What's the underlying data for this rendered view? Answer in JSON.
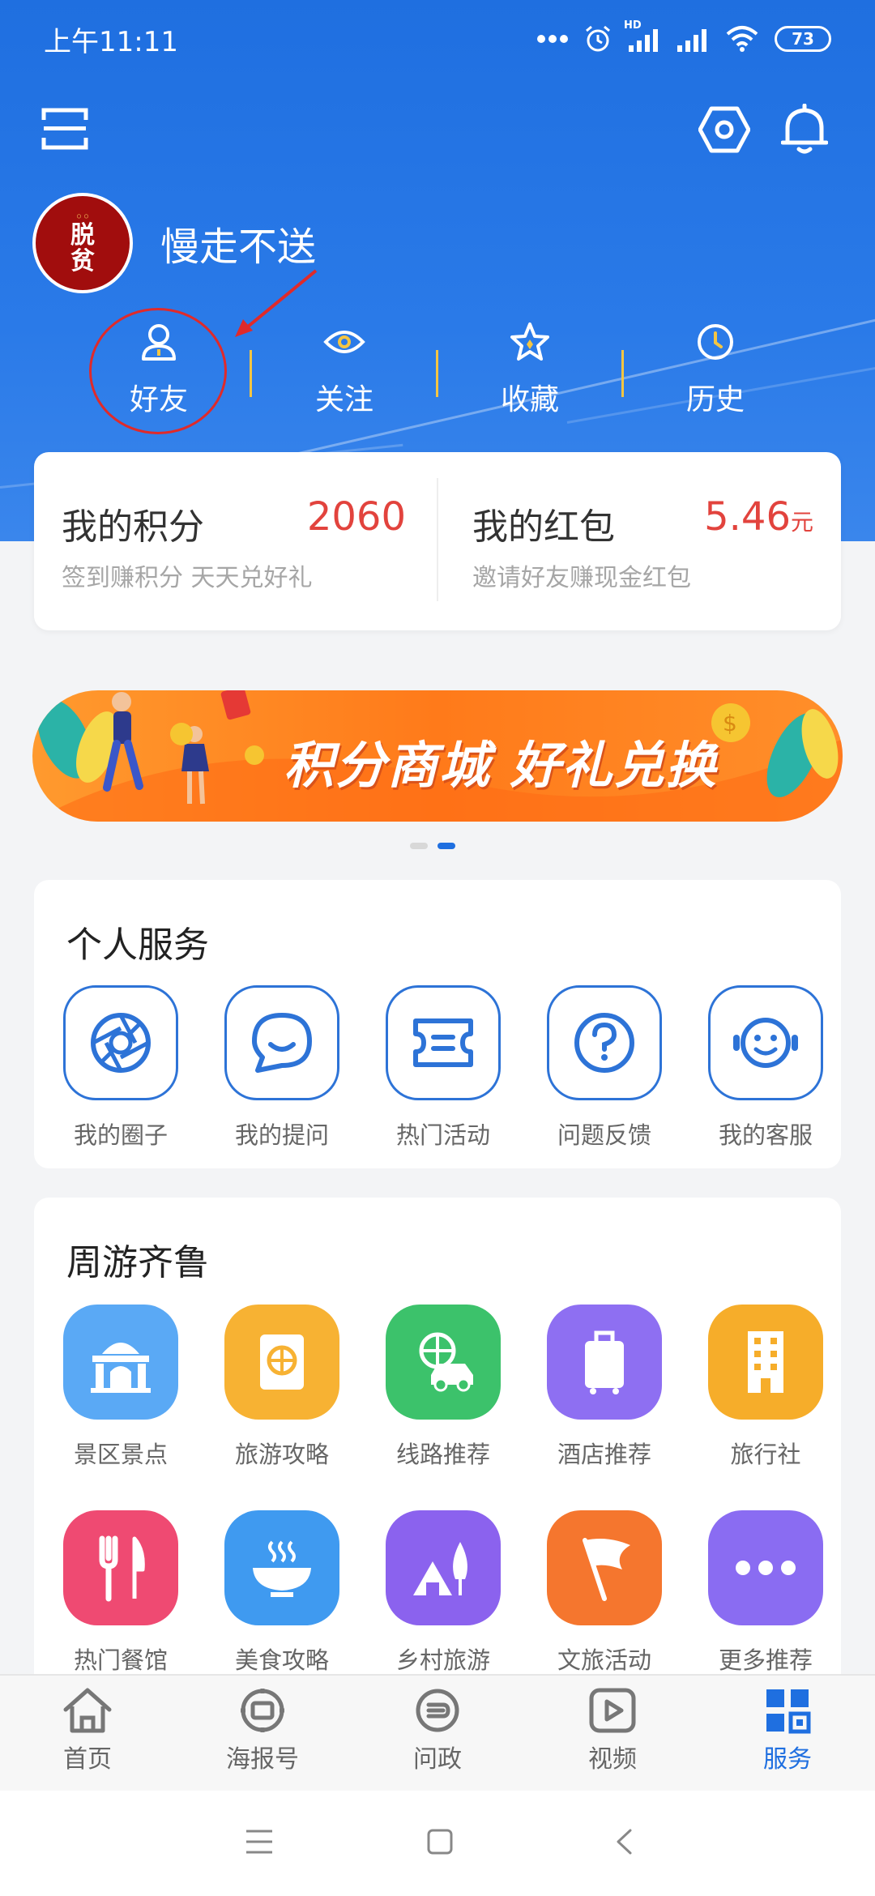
{
  "status_bar": {
    "time": "上午11:11",
    "battery": "73",
    "network_label": "HD"
  },
  "profile": {
    "avatar_text_1": "脱",
    "avatar_text_2": "贫",
    "username": "慢走不送"
  },
  "quick_links": [
    {
      "label": "好友",
      "icon": "user-icon"
    },
    {
      "label": "关注",
      "icon": "eye-icon"
    },
    {
      "label": "收藏",
      "icon": "star-icon"
    },
    {
      "label": "历史",
      "icon": "clock-icon"
    }
  ],
  "points": {
    "title": "我的积分",
    "value": "2060",
    "subtitle": "签到赚积分 天天兑好礼"
  },
  "red_packet": {
    "title": "我的红包",
    "value": "5.46",
    "unit": "元",
    "subtitle": "邀请好友赚现金红包"
  },
  "banner": {
    "text": "积分商城 好礼兑换",
    "page_count": 2,
    "active_page": 2
  },
  "personal_services": {
    "title": "个人服务",
    "items": [
      {
        "label": "我的圈子",
        "icon": "aperture-icon"
      },
      {
        "label": "我的提问",
        "icon": "chat-bubble-icon"
      },
      {
        "label": "热门活动",
        "icon": "ticket-icon"
      },
      {
        "label": "问题反馈",
        "icon": "question-icon"
      },
      {
        "label": "我的客服",
        "icon": "headset-icon"
      }
    ]
  },
  "travel": {
    "title": "周游齐鲁",
    "row1": [
      {
        "label": "景区景点",
        "icon": "landmark-icon",
        "color": "#5aa9f5"
      },
      {
        "label": "旅游攻略",
        "icon": "passport-icon",
        "color": "#f7b233"
      },
      {
        "label": "线路推荐",
        "icon": "car-globe-icon",
        "color": "#3cc26b"
      },
      {
        "label": "酒店推荐",
        "icon": "luggage-icon",
        "color": "#8e6ff2"
      },
      {
        "label": "旅行社",
        "icon": "building-icon",
        "color": "#f6ad2a"
      }
    ],
    "row2": [
      {
        "label": "热门餐馆",
        "icon": "fork-knife-icon",
        "color": "#ef4a72"
      },
      {
        "label": "美食攻略",
        "icon": "bowl-icon",
        "color": "#3f9af0"
      },
      {
        "label": "乡村旅游",
        "icon": "village-icon",
        "color": "#8b62ee"
      },
      {
        "label": "文旅活动",
        "icon": "flag-icon",
        "color": "#f5762e"
      },
      {
        "label": "更多推荐",
        "icon": "more-icon",
        "color": "#8a6cf2"
      }
    ]
  },
  "bottom_nav": [
    {
      "label": "首页",
      "icon": "home-icon"
    },
    {
      "label": "海报号",
      "icon": "poster-icon"
    },
    {
      "label": "问政",
      "icon": "inquiry-icon"
    },
    {
      "label": "视频",
      "icon": "video-icon"
    },
    {
      "label": "服务",
      "icon": "grid-icon",
      "active": true
    }
  ],
  "colors": {
    "brand_blue": "#1f6fe0",
    "accent_red": "#e2433d",
    "divider_yellow": "#f4c542"
  }
}
